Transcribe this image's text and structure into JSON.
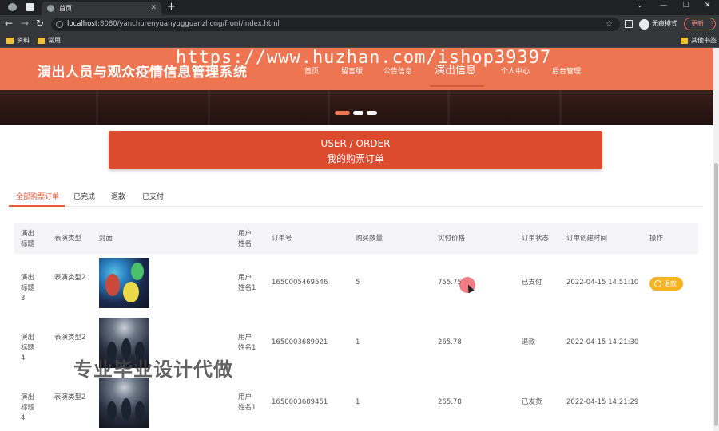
{
  "browser": {
    "tab_title": "首页",
    "url_host": "localhost",
    "url_rest": ":8080/yanchurenyuanyugguanzhong/front/index.html",
    "incognito_label": "无痕模式",
    "update_label": "更新",
    "bookmarks": [
      "资料",
      "常用"
    ],
    "other_bookmarks": "其他书签"
  },
  "watermark": "https://www.huzhan.com/ishop39397",
  "header": {
    "site_title": "演出人员与观众疫情信息管理系统",
    "nav": [
      "首页",
      "留言版",
      "公告信息",
      "演出信息",
      "个人中心",
      "后台管理"
    ]
  },
  "banner_title": {
    "en": "USER / ORDER",
    "cn": "我的购票订单"
  },
  "tabs": [
    "全部购票订单",
    "已完成",
    "退款",
    "已支付"
  ],
  "table": {
    "headers": [
      "演出标题",
      "表演类型",
      "封面",
      "用户姓名",
      "订单号",
      "购买数量",
      "实付价格",
      "订单状态",
      "订单创建时间",
      "操作"
    ],
    "rows": [
      {
        "title": "演出标题3",
        "type": "表演类型2",
        "user": "用户姓名1",
        "order_no": "1650005469546",
        "qty": "5",
        "price": "755.75",
        "status": "已支付",
        "created": "2022-04-15 14:51:10",
        "action": "退款"
      },
      {
        "title": "演出标题4",
        "type": "表演类型2",
        "user": "用户姓名1",
        "order_no": "1650003689921",
        "qty": "1",
        "price": "265.78",
        "status": "退款",
        "created": "2022-04-15 14:21:30",
        "action": ""
      },
      {
        "title": "演出标题4",
        "type": "表演类型2",
        "user": "用户姓名1",
        "order_no": "1650003689451",
        "qty": "1",
        "price": "265.78",
        "status": "已发货",
        "created": "2022-04-15 14:21:29",
        "action": ""
      }
    ]
  },
  "overlay_text": "专业毕业设计代做",
  "colors": {
    "header": "#ee7551",
    "title_box": "#dc4b2d",
    "refund_button": "#f5b41f",
    "active_tab": "#e85a3a"
  }
}
